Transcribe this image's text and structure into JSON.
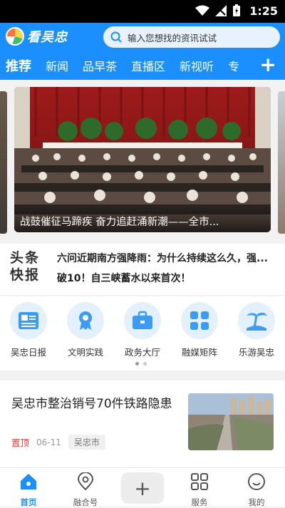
{
  "status_bar": {
    "time": "1:25"
  },
  "header": {
    "app_name": "看吴忠",
    "search_placeholder": "输入您想找的资讯试试"
  },
  "tabs": [
    {
      "label": "推荐",
      "active": true
    },
    {
      "label": "新闻"
    },
    {
      "label": "品早茶"
    },
    {
      "label": "直播区"
    },
    {
      "label": "新视听"
    },
    {
      "label": "专"
    }
  ],
  "banner": {
    "caption": "战鼓催征马蹄疾 奋力追赶涌新潮——全市..."
  },
  "headline_block": {
    "logo_line1": "头条",
    "logo_line2": "快报",
    "items": [
      "六问近期南方强降雨：为什么持续这么久，强...",
      "破10！自三峡蓄水以来首次！"
    ]
  },
  "services": [
    {
      "label": "吴忠日报",
      "icon": "newspaper-icon"
    },
    {
      "label": "文明实践",
      "icon": "flower-medal-icon"
    },
    {
      "label": "政务大厅",
      "icon": "briefcase-icon"
    },
    {
      "label": "融媒矩阵",
      "icon": "grid-icon"
    },
    {
      "label": "乐游吴忠",
      "icon": "palm-tree-icon"
    }
  ],
  "article": {
    "title": "吴忠市整治销号70件铁路隐患",
    "pin": "置顶",
    "date": "06-11",
    "source": "吴忠市"
  },
  "bottom_nav": [
    {
      "label": "首页",
      "icon": "home-icon",
      "active": true
    },
    {
      "label": "融合号",
      "icon": "location-pin-icon"
    },
    {
      "label": "",
      "icon": "plus-icon"
    },
    {
      "label": "服务",
      "icon": "grid-icon"
    },
    {
      "label": "我的",
      "icon": "profile-icon"
    }
  ],
  "colors": {
    "primary": "#1a8ffd",
    "pin_red": "#e53935",
    "accent_orange": "#ff7a1a"
  }
}
